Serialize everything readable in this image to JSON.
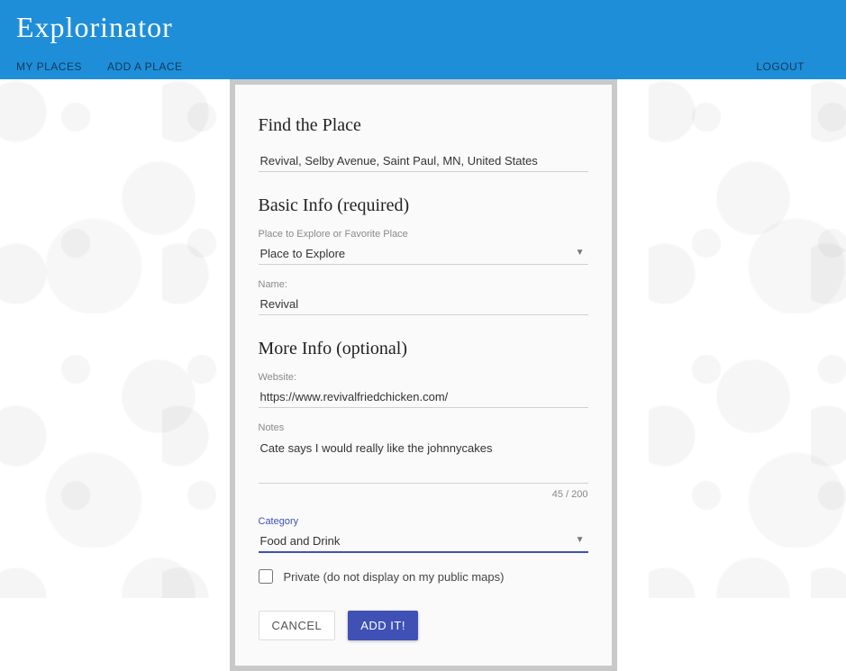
{
  "brand": "Explorinator",
  "nav": {
    "my_places": "MY PLACES",
    "add_place": "ADD A PLACE",
    "logout": "LOGOUT"
  },
  "form": {
    "find_heading": "Find the Place",
    "find_value": "Revival, Selby Avenue, Saint Paul, MN, United States",
    "basic_heading": "Basic Info (required)",
    "type_label": "Place to Explore or Favorite Place",
    "type_value": "Place to Explore",
    "name_label": "Name:",
    "name_value": "Revival",
    "more_heading": "More Info (optional)",
    "website_label": "Website:",
    "website_value": "https://www.revivalfriedchicken.com/",
    "notes_label": "Notes",
    "notes_value": "Cate says I would really like the johnnycakes",
    "notes_counter": "45 / 200",
    "category_label": "Category",
    "category_value": "Food and Drink",
    "private_label": "Private (do not display on my public maps)",
    "cancel_label": "CANCEL",
    "submit_label": "ADD IT!"
  }
}
